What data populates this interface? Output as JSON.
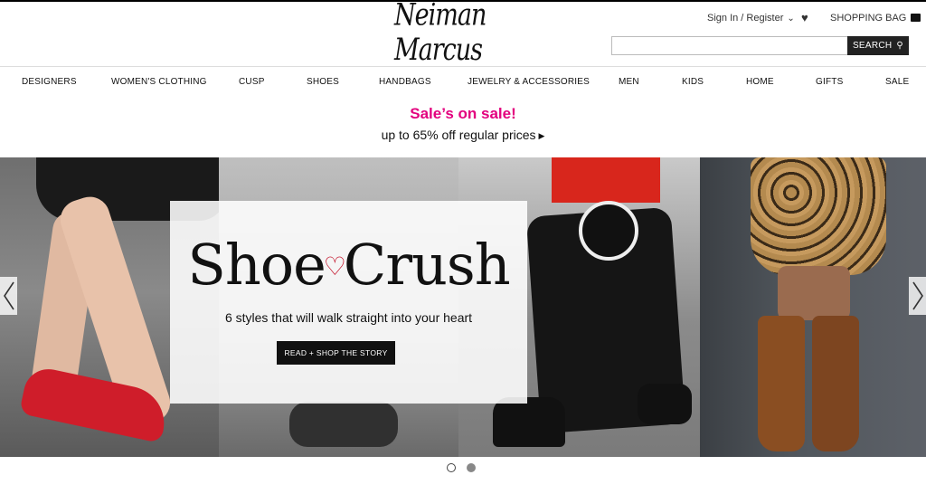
{
  "header": {
    "logo_text": "Neiman Marcus",
    "sign_in_label": "Sign In / Register",
    "shopping_bag_label": "SHOPPING BAG",
    "search": {
      "placeholder": "",
      "button_label": "SEARCH"
    }
  },
  "nav": {
    "items": [
      {
        "label": "DESIGNERS"
      },
      {
        "label": "WOMEN'S CLOTHING"
      },
      {
        "label": "CUSP"
      },
      {
        "label": "SHOES"
      },
      {
        "label": "HANDBAGS"
      },
      {
        "label": "JEWELRY & ACCESSORIES"
      },
      {
        "label": "MEN"
      },
      {
        "label": "KIDS"
      },
      {
        "label": "HOME"
      },
      {
        "label": "GIFTS"
      },
      {
        "label": "SALE"
      }
    ]
  },
  "promo": {
    "title": "Sale’s on sale!",
    "subtitle": "up to 65% off regular prices",
    "title_color": "#e3007e"
  },
  "hero": {
    "brand_left": "Shoe",
    "brand_right": "Crush",
    "heart_color": "#c0001a",
    "tagline": "6 styles that will walk straight into your heart",
    "cta_label": "READ + SHOP THE STORY"
  },
  "carousel": {
    "slide_count": 2,
    "active_index": 2
  },
  "icons": {
    "heart": "heart-icon",
    "bag": "shopping-bag-icon",
    "search": "search-icon",
    "prev": "chevron-left-icon",
    "next": "chevron-right-icon"
  }
}
